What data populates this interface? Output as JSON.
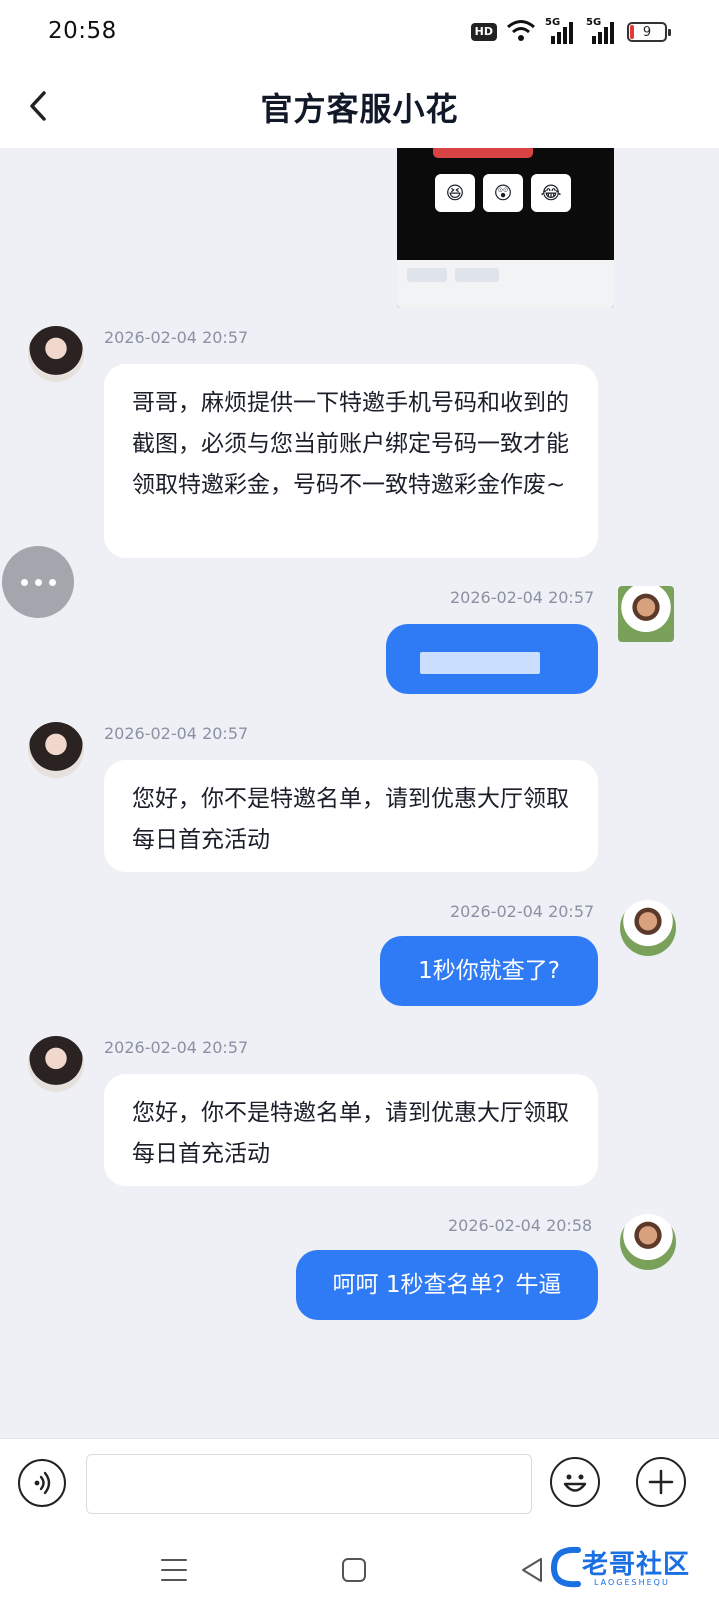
{
  "status_bar": {
    "time": "20:58",
    "hd_label": "HD",
    "network_1": "5G",
    "network_2": "5G",
    "battery_level": "9",
    "icons": [
      "hd-icon",
      "wifi-icon",
      "signal-icon",
      "signal-icon",
      "battery-icon"
    ]
  },
  "header": {
    "title": "官方客服小花",
    "back_icon": "chevron-left-icon"
  },
  "messages": [
    {
      "sender": "agent",
      "timestamp": "2026-02-04 20:57",
      "text": "哥哥，麻烦提供一下特邀手机号码和收到的截图，必须与您当前账户绑定号码一致才能领取特邀彩金，号码不一致特邀彩金作废~"
    },
    {
      "sender": "user",
      "timestamp": "2026-02-04 20:57",
      "text": ""
    },
    {
      "sender": "agent",
      "timestamp": "2026-02-04 20:57",
      "text": "您好，你不是特邀名单，请到优惠大厅领取每日首充活动"
    },
    {
      "sender": "user",
      "timestamp": "2026-02-04 20:57",
      "text": "1秒你就查了?"
    },
    {
      "sender": "agent",
      "timestamp": "2026-02-04 20:57",
      "text": "您好，你不是特邀名单，请到优惠大厅领取每日首充活动"
    },
    {
      "sender": "user",
      "timestamp": "2026-02-04 20:58",
      "text": "呵呵 1秒查名单？牛逼"
    }
  ],
  "input_bar": {
    "voice_icon": "voice-icon",
    "placeholder": "",
    "emoji_icon": "emoji-icon",
    "add_icon": "plus-icon"
  },
  "watermark": {
    "text": "老哥社区",
    "sub": "LAOGESHEQU"
  },
  "colors": {
    "accent": "#2f7bf5",
    "background": "#eef0f6",
    "agent_bubble": "#ffffff"
  }
}
